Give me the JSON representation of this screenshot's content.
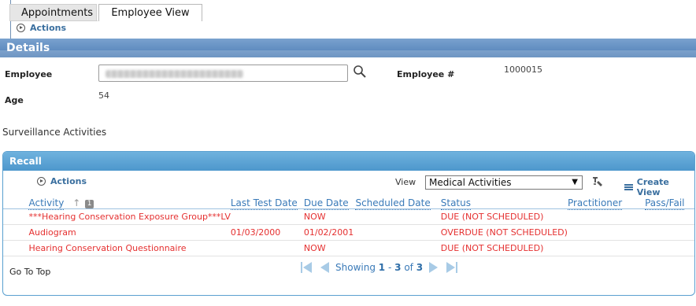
{
  "tabs": [
    {
      "label": "Appointments",
      "active": false
    },
    {
      "label": "Employee View",
      "active": true
    }
  ],
  "top_actions_label": "Actions",
  "details": {
    "title": "Details",
    "employee_label": "Employee",
    "employee_value_redacted": true,
    "employee_number_label": "Employee #",
    "employee_number": "1000015",
    "age_label": "Age",
    "age": "54"
  },
  "surveillance_title": "Surveillance Activities",
  "recall": {
    "title": "Recall",
    "actions_label": "Actions",
    "view_label": "View",
    "view_selected": "Medical Activities",
    "create_view_label": "Create View",
    "columns": [
      "Activity",
      "Last Test Date",
      "Due Date",
      "Scheduled Date",
      "Status",
      "Practitioner",
      "Pass/Fail"
    ],
    "sort_badge": "1",
    "rows": [
      {
        "activity": "***Hearing Conservation Exposure Group***LV",
        "last_test": "",
        "due": "NOW",
        "scheduled": "",
        "status": "DUE (NOT SCHEDULED)",
        "practitioner": "",
        "pass_fail": ""
      },
      {
        "activity": "Audiogram",
        "last_test": "01/03/2000",
        "due": "01/02/2001",
        "scheduled": "",
        "status": "OVERDUE (NOT SCHEDULED)",
        "practitioner": "",
        "pass_fail": ""
      },
      {
        "activity": "Hearing Conservation Questionnaire",
        "last_test": "",
        "due": "NOW",
        "scheduled": "",
        "status": "DUE (NOT SCHEDULED)",
        "practitioner": "",
        "pass_fail": ""
      }
    ],
    "goto_top": "Go To Top",
    "paging": {
      "prefix": "Showing",
      "from": "1",
      "sep": "-",
      "to": "3",
      "of_word": "of",
      "total": "3"
    }
  },
  "colors": {
    "header_blue": "#4f7fb6",
    "panel_blue": "#4d97cc",
    "row_red": "#e53030",
    "link_blue": "#3a6f9f"
  }
}
